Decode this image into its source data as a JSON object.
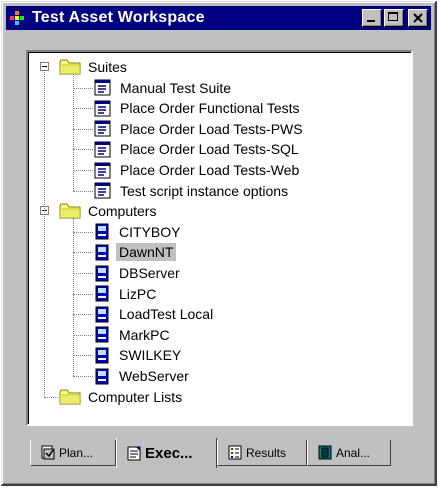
{
  "window": {
    "title": "Test Asset Workspace",
    "controls": [
      "minimize",
      "maximize",
      "close"
    ]
  },
  "tree": {
    "groups": [
      {
        "label": "Suites",
        "expanded": true,
        "children": [
          "Manual Test Suite",
          "Place Order Functional Tests",
          "Place Order Load Tests-PWS",
          "Place Order Load Tests-SQL",
          "Place Order Load Tests-Web",
          "Test script instance options"
        ]
      },
      {
        "label": "Computers",
        "expanded": true,
        "children": [
          "CITYBOY",
          "DawnNT",
          "DBServer",
          "LizPC",
          "LoadTest Local",
          "MarkPC",
          "SWILKEY",
          "WebServer"
        ],
        "selected": "DawnNT"
      },
      {
        "label": "Computer Lists",
        "expanded": false,
        "children": []
      }
    ]
  },
  "tabs": [
    {
      "label": "Plan...",
      "active": false
    },
    {
      "label": "Exec...",
      "active": true
    },
    {
      "label": "Results",
      "active": false
    },
    {
      "label": "Anal...",
      "active": false
    }
  ]
}
